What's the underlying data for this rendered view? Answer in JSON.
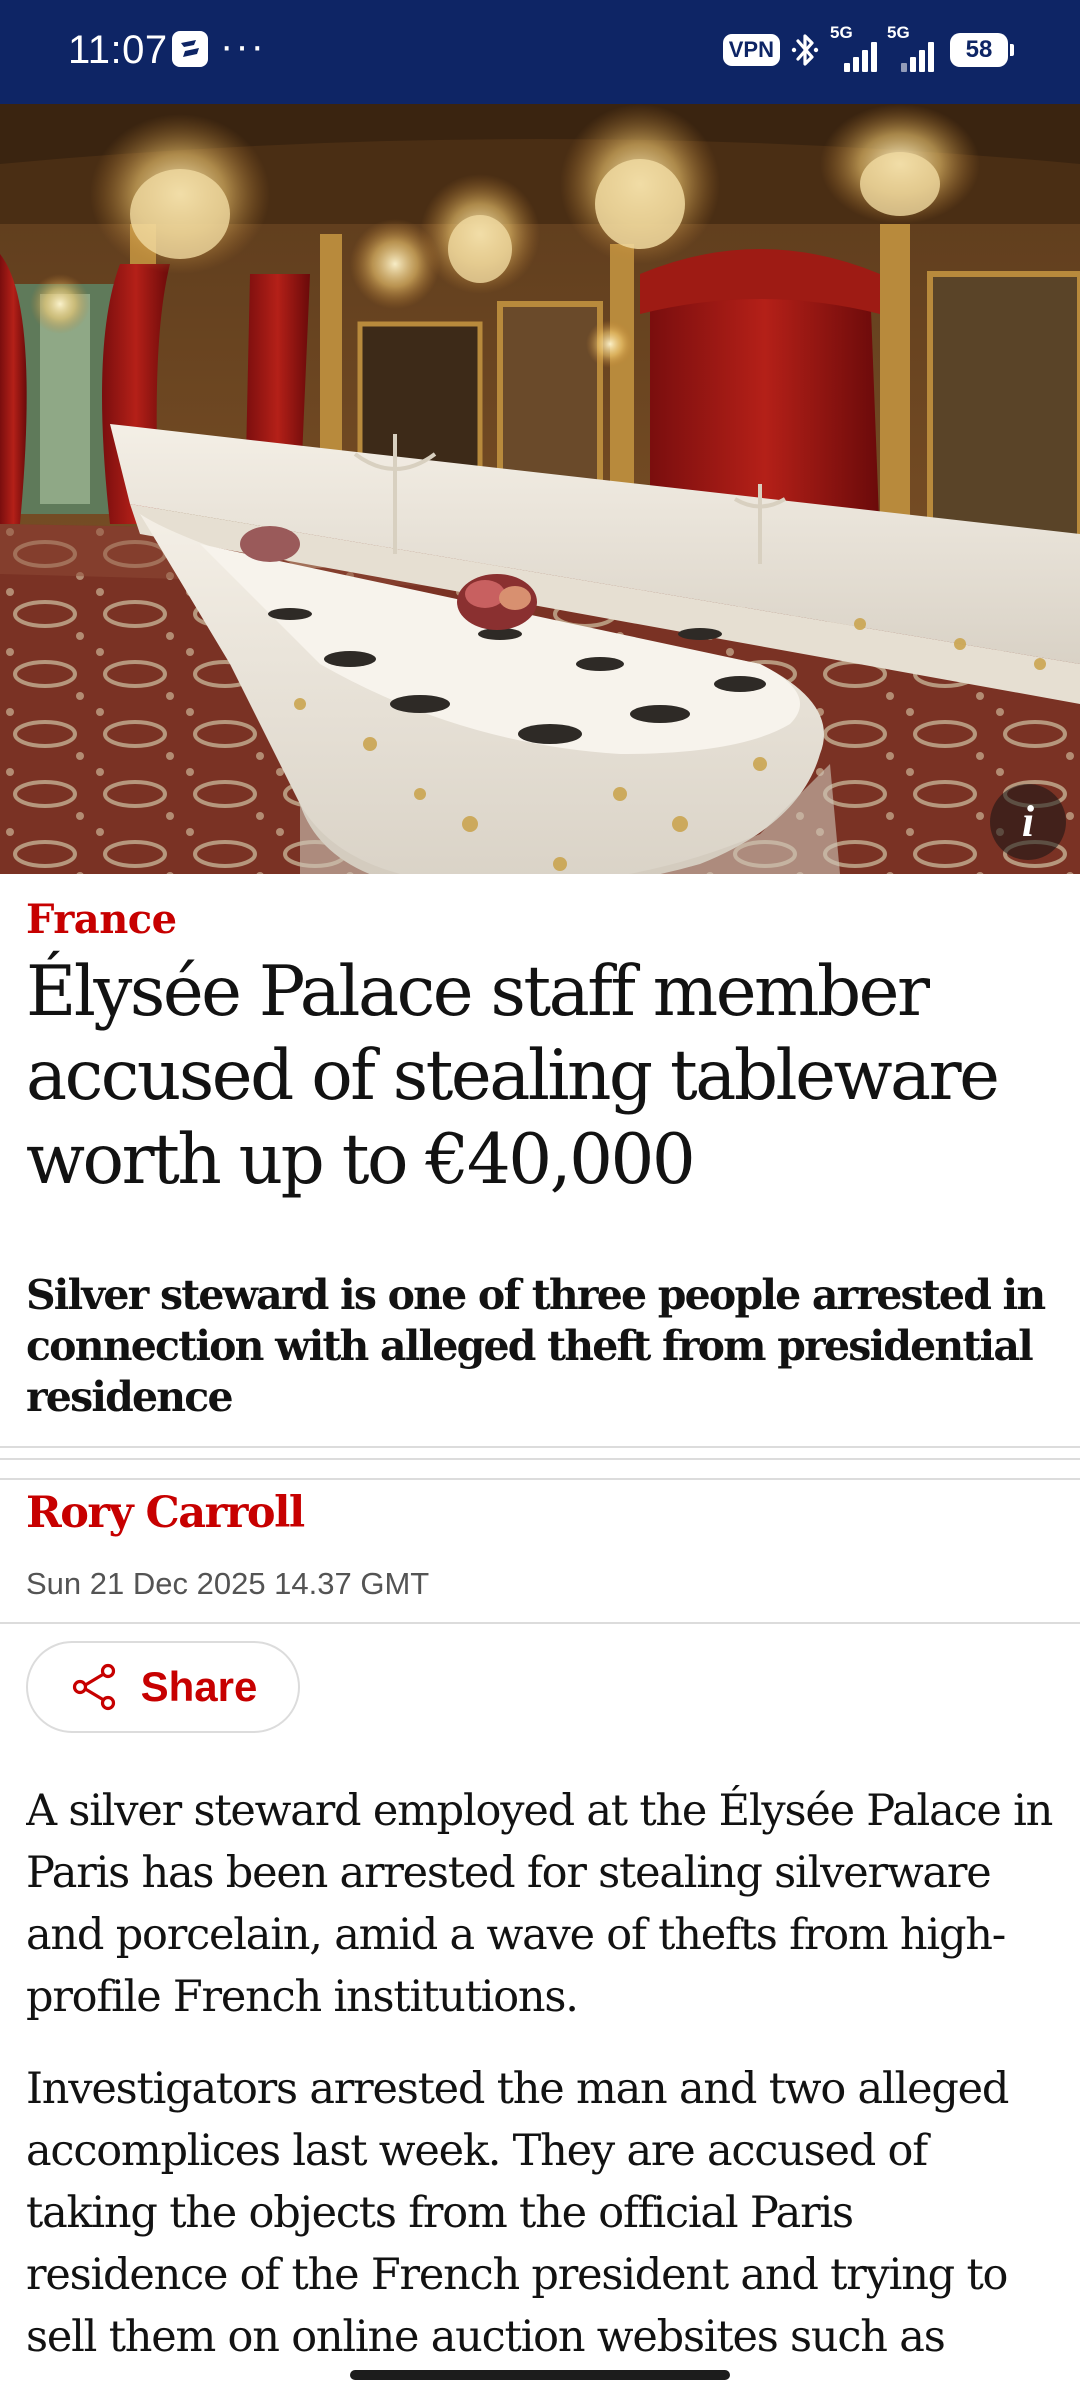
{
  "status_bar": {
    "time": "11:07",
    "more": "···",
    "vpn": "VPN",
    "network_1": "5G",
    "network_2": "5G",
    "battery": "58",
    "background_color": "#0e2565"
  },
  "hero": {
    "info_label": "i",
    "info_icon": "info-icon"
  },
  "article": {
    "section": "France",
    "headline": "Élysée Palace staff member accused of stealing tableware worth up to €40,000",
    "standfirst": "Silver steward is one of three people arrested in connection with alleged theft from presidential residence",
    "byline": "Rory Carroll",
    "dateline": "Sun 21 Dec 2025 14.37 GMT",
    "share_label": "Share",
    "share_icon": "share-icon",
    "paragraphs": [
      "A silver steward employed at the Élysée Palace in Paris has been arrested for stealing silverware and porcelain, amid a wave of thefts from high-profile French institutions.",
      "Investigators arrested the man and two alleged accomplices last week. They are accused of taking the objects from the official Paris residence of the French president and trying to sell them on online auction websites such as"
    ]
  },
  "colors": {
    "accent_red": "#c70000",
    "text": "#121212",
    "muted": "#545454",
    "rule": "#dcdcdc"
  }
}
